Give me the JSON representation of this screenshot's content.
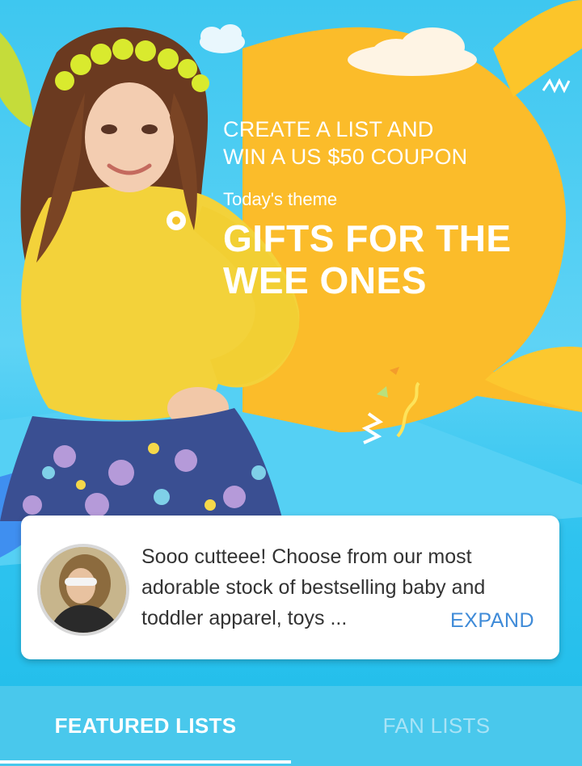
{
  "promo": {
    "headline_line1": "CREATE A LIST AND",
    "headline_line2": "WIN A US $50 COUPON",
    "theme_label": "Today's theme",
    "theme_title_line1": "GIFTS FOR THE",
    "theme_title_line2": "WEE ONES"
  },
  "card": {
    "description": "Sooo cutteee! Choose from our most adorable stock of bestselling baby and toddler apparel, toys ...",
    "expand_label": "EXPAND"
  },
  "tabs": [
    {
      "label": "FEATURED LISTS",
      "active": true
    },
    {
      "label": "FAN LISTS",
      "active": false
    }
  ],
  "colors": {
    "background": "#3ec7f0",
    "promo_bubble": "#fbbc2a",
    "accent_link": "#3f8bd8",
    "tab_bar": "#49c8ec"
  }
}
